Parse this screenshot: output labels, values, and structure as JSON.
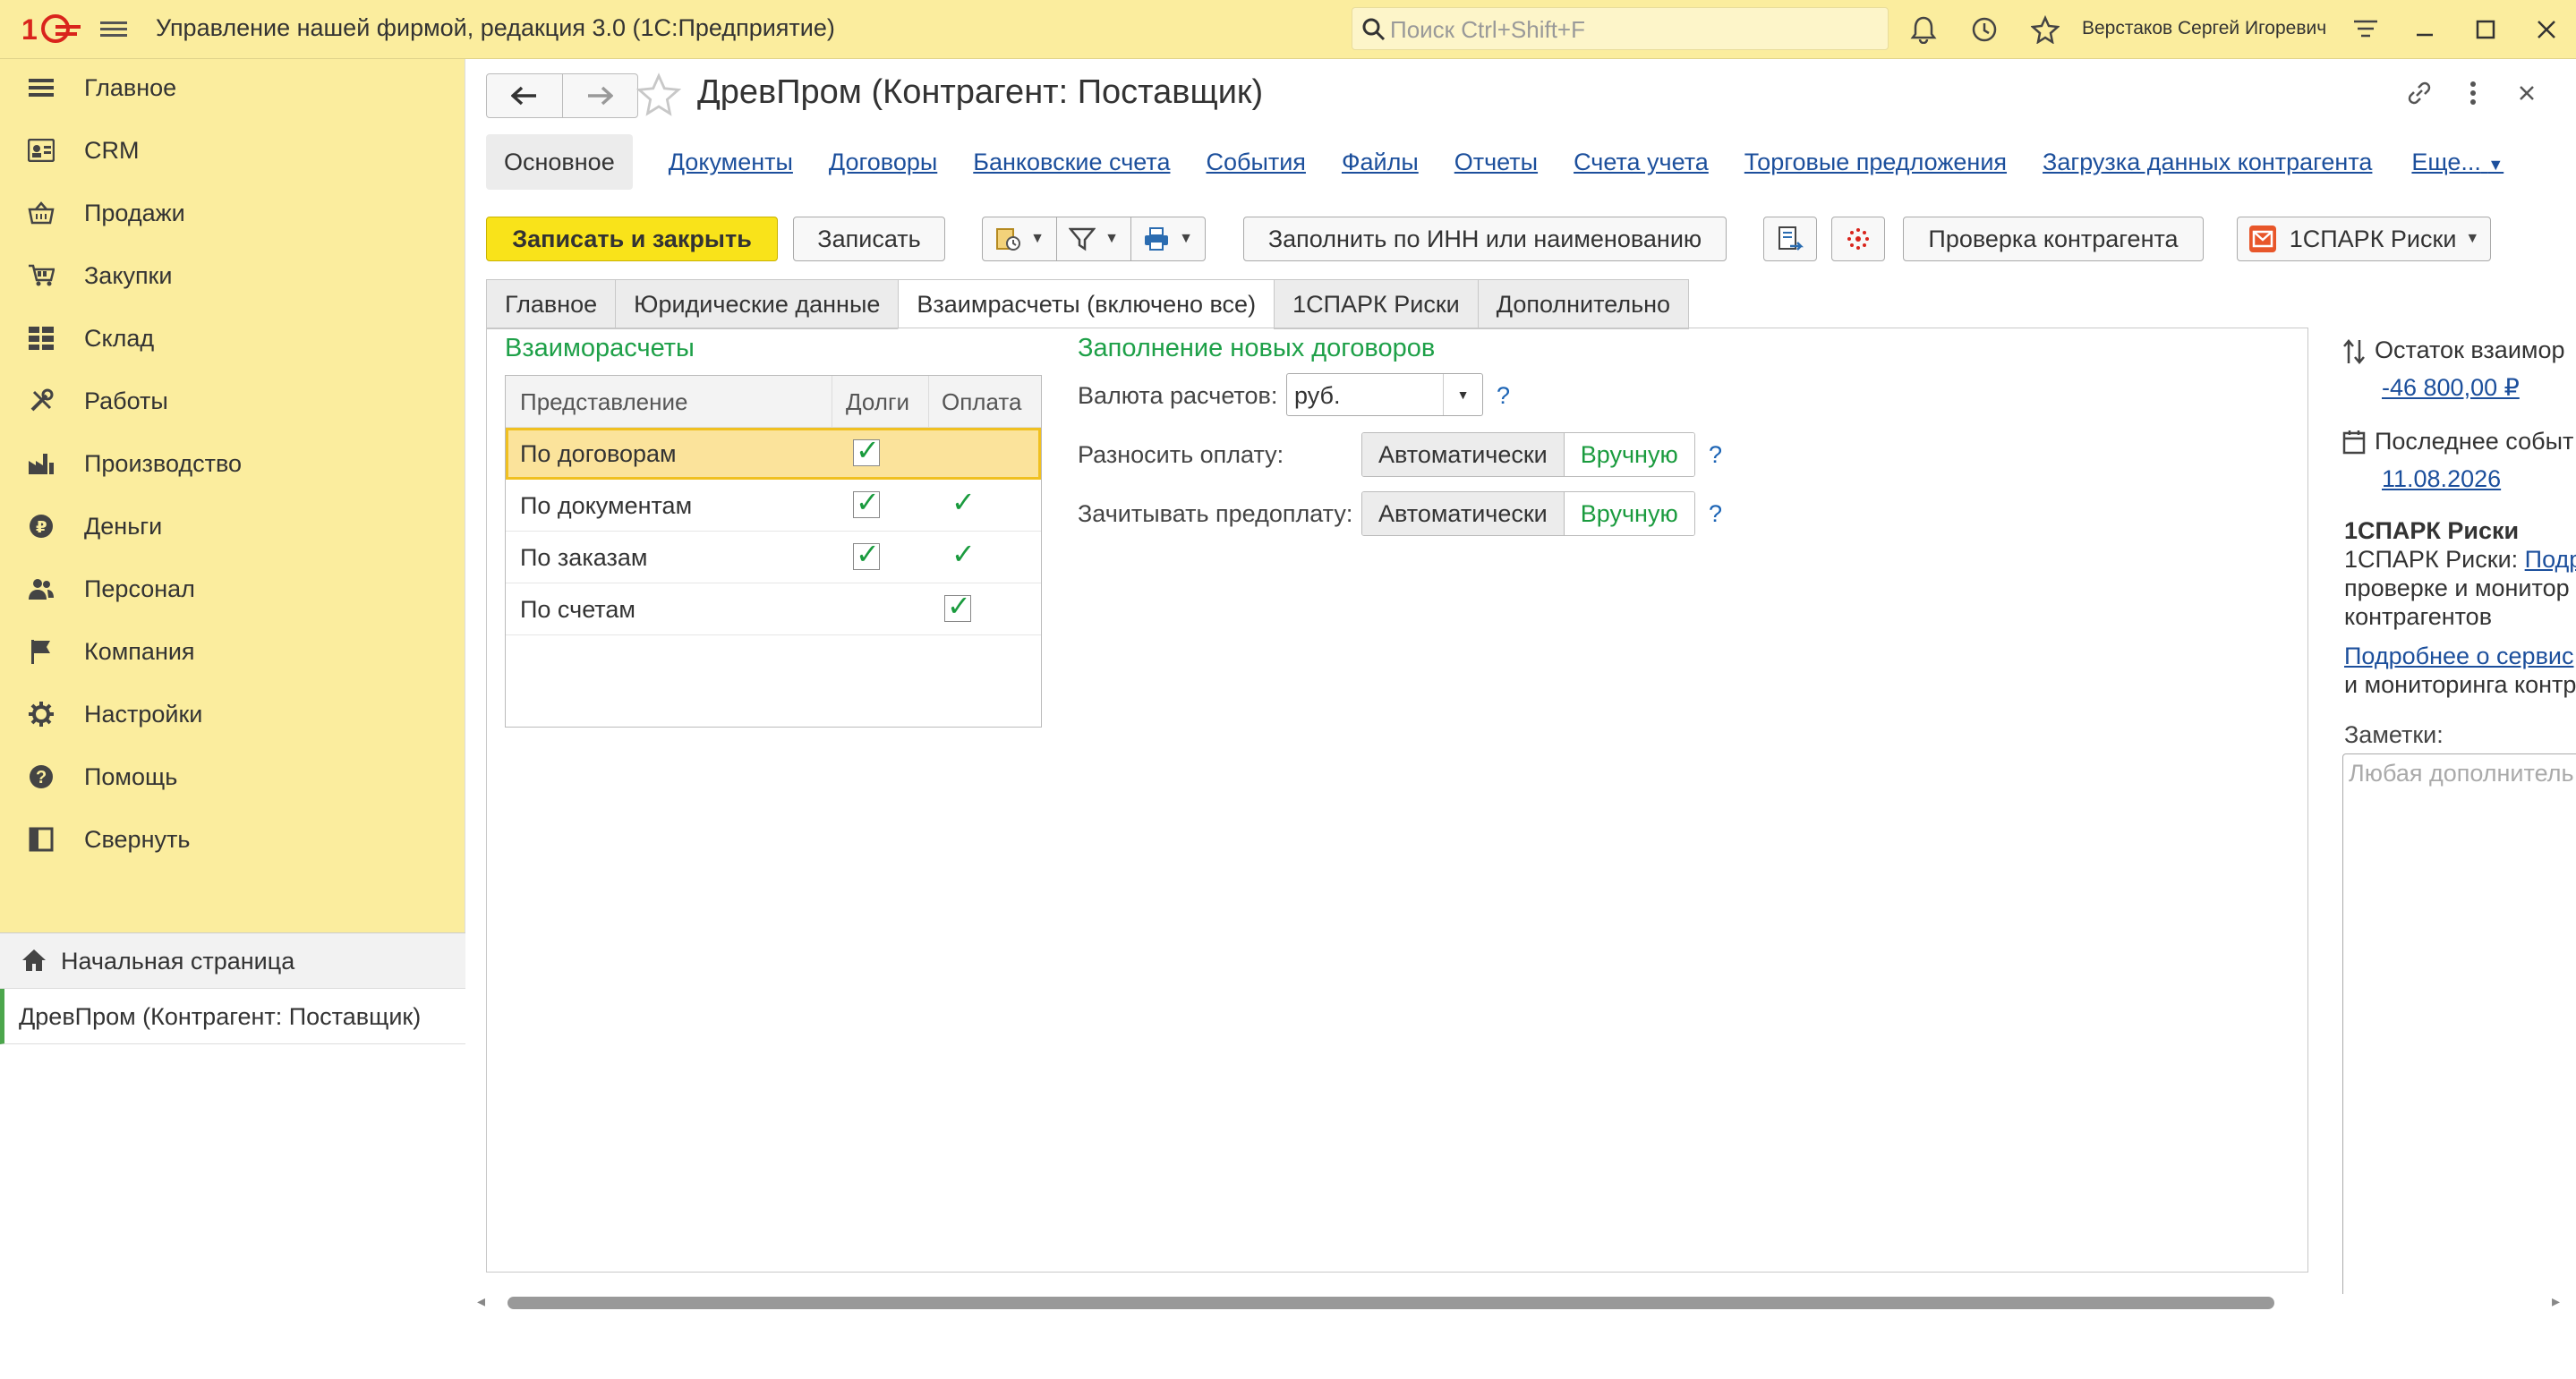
{
  "app": {
    "title": "Управление нашей фирмой, редакция 3.0  (1С:Предприятие)",
    "logo_text": "1С"
  },
  "search": {
    "placeholder": "Поиск Ctrl+Shift+F"
  },
  "user": {
    "name": "Верстаков Сергей Игоревич"
  },
  "sidebar": {
    "items": [
      {
        "label": "Главное",
        "icon": "menu-lines-icon"
      },
      {
        "label": "CRM",
        "icon": "contact-card-icon"
      },
      {
        "label": "Продажи",
        "icon": "basket-icon"
      },
      {
        "label": "Закупки",
        "icon": "cart-icon"
      },
      {
        "label": "Склад",
        "icon": "warehouse-grid-icon"
      },
      {
        "label": "Работы",
        "icon": "tools-icon"
      },
      {
        "label": "Производство",
        "icon": "factory-icon"
      },
      {
        "label": "Деньги",
        "icon": "ruble-coin-icon"
      },
      {
        "label": "Персонал",
        "icon": "people-icon"
      },
      {
        "label": "Компания",
        "icon": "flag-icon"
      },
      {
        "label": "Настройки",
        "icon": "gear-icon"
      },
      {
        "label": "Помощь",
        "icon": "help-icon"
      },
      {
        "label": "Свернуть",
        "icon": "collapse-panel-icon"
      }
    ],
    "home": "Начальная страница",
    "open_doc": "ДревПром (Контрагент: Поставщик)"
  },
  "document": {
    "title": "ДревПром (Контрагент: Поставщик)"
  },
  "links": {
    "active": "Основное",
    "items": [
      "Документы",
      "Договоры",
      "Банковские счета",
      "События",
      "Файлы",
      "Отчеты",
      "Счета учета",
      "Торговые предложения",
      "Загрузка данных контрагента"
    ],
    "more": "Еще..."
  },
  "toolbar": {
    "save_close": "Записать и закрыть",
    "save": "Записать",
    "fill_inn": "Заполнить по ИНН или наименованию",
    "check": "Проверка контрагента",
    "spark": "1СПАРК Риски"
  },
  "tabs": [
    "Главное",
    "Юридические данные",
    "Взаимрасчеты (включено все)",
    "1СПАРК Риски",
    "Дополнительно"
  ],
  "settlements": {
    "title": "Взаиморасчеты",
    "columns": [
      "Представление",
      "Долги",
      "Оплата"
    ],
    "rows": [
      {
        "label": "По договорам",
        "debts": true,
        "payment": false
      },
      {
        "label": "По документам",
        "debts": true,
        "payment": true
      },
      {
        "label": "По заказам",
        "debts": true,
        "payment": true
      },
      {
        "label": "По счетам",
        "debts": false,
        "payment": true
      }
    ]
  },
  "new_contracts": {
    "title": "Заполнение новых договоров",
    "currency_label": "Валюта расчетов:",
    "currency_value": "руб.",
    "distribute_label": "Разносить оплату:",
    "offset_label": "Зачитывать предоплату:",
    "auto": "Автоматически",
    "manual": "Вручную",
    "help": "?"
  },
  "right_panel": {
    "balance_label": "Остаток взаимор",
    "balance_value": "-46 800,00 ₽",
    "last_event_label": "Последнее событ",
    "last_event_value": "11.08.2026",
    "spark_title": "1СПАРК Риски",
    "spark_text1": "1СПАРК Риски: ",
    "spark_link1": "Подр",
    "spark_text2": "проверке и монитор",
    "spark_text3": "контрагентов",
    "spark_link2": "Подробнее о сервис",
    "spark_text4": "и мониторинга контр",
    "notes_label": "Заметки:",
    "notes_placeholder": "Любая дополнитель"
  }
}
